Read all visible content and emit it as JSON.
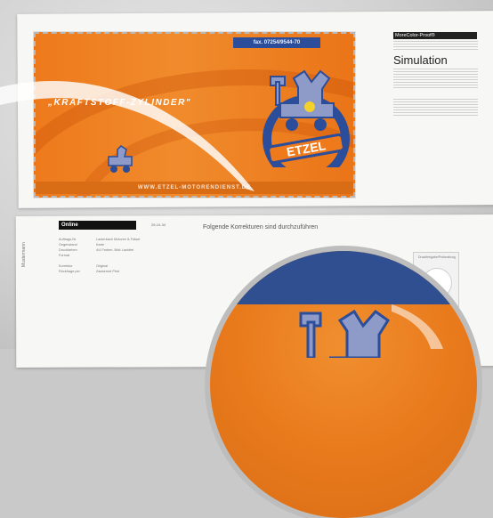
{
  "card": {
    "top_label": "fax. 07254/9544-70",
    "headline": "„KRAFTSTOFF-ZYLINDER\"",
    "logo_text": "ETZEL",
    "footer": "WWW.ETZEL-MOTORENDIENST.DE"
  },
  "sidebar": {
    "badge": "MoreColor-Proof®",
    "heading": "Simulation"
  },
  "form": {
    "online": "Online",
    "date": "25-10-34",
    "heading": "Folgende Korrekturen sind durchzuführen",
    "vertical": "Mustermann",
    "meta": [
      {
        "k": "Auftrags-Nr.",
        "v": "Lauterbach Motoren & Fräser"
      },
      {
        "k": "Gegenstand",
        "v": "Karte"
      },
      {
        "k": "Druckfarben",
        "v": "4/4 Farben, Bild: Lackfrei"
      },
      {
        "k": "Format",
        "v": ""
      },
      {
        "k": "Korrektur",
        "v": "Original"
      },
      {
        "k": "Rückfrage per",
        "v": "Zaubernet Print"
      }
    ],
    "stamp_label": "Druckfreigabe/Probeabzug"
  },
  "colors": {
    "orange": "#ee7a1c",
    "navy": "#2b4d9a"
  }
}
